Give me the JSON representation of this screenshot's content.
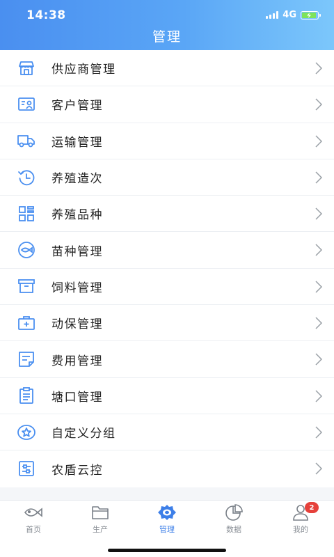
{
  "status": {
    "time": "14:38",
    "network": "4G",
    "battery_level": 0.9
  },
  "header": {
    "title": "管理"
  },
  "menu": {
    "items": [
      {
        "label": "供应商管理",
        "icon": "store-icon"
      },
      {
        "label": "客户管理",
        "icon": "id-card-icon"
      },
      {
        "label": "运输管理",
        "icon": "truck-icon"
      },
      {
        "label": "养殖造次",
        "icon": "history-icon"
      },
      {
        "label": "养殖品种",
        "icon": "grid-icon"
      },
      {
        "label": "苗种管理",
        "icon": "fish-icon"
      },
      {
        "label": "饲料管理",
        "icon": "archive-box-icon"
      },
      {
        "label": "动保管理",
        "icon": "medical-kit-icon"
      },
      {
        "label": "费用管理",
        "icon": "note-icon"
      },
      {
        "label": "塘口管理",
        "icon": "clipboard-icon"
      },
      {
        "label": "自定义分组",
        "icon": "star-badge-icon"
      },
      {
        "label": "农盾云控",
        "icon": "control-panel-icon"
      }
    ]
  },
  "tabbar": {
    "tabs": [
      {
        "label": "首页",
        "icon": "fish-home-icon"
      },
      {
        "label": "生产",
        "icon": "folder-icon"
      },
      {
        "label": "管理",
        "icon": "gear-icon"
      },
      {
        "label": "数据",
        "icon": "pie-chart-icon"
      },
      {
        "label": "我的",
        "icon": "user-icon"
      }
    ],
    "active_index": 2,
    "badge_count": "2"
  },
  "colors": {
    "accent": "#3d7fe8",
    "icon_blue": "#4a8ff0",
    "badge": "#e6413b"
  }
}
